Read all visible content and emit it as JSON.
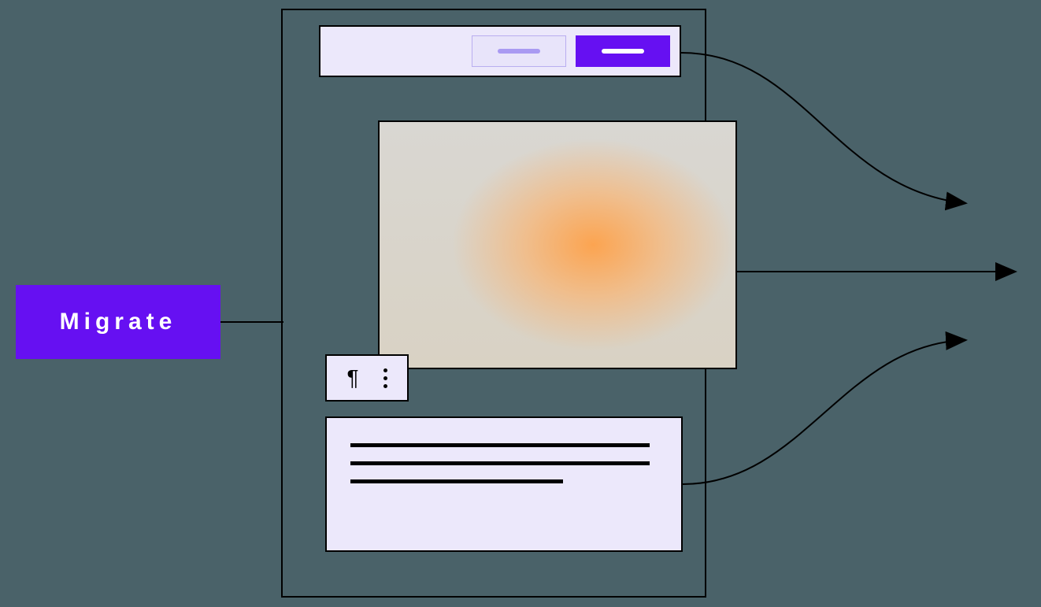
{
  "input": {
    "label": "Migrate"
  },
  "toolbar": {
    "secondary_button": "secondary-action",
    "primary_button": "primary-action"
  },
  "format_bar": {
    "paragraph_icon": "pilcrow-icon",
    "more_icon": "more-vertical-icon"
  },
  "diagram": {
    "text_lines": 3,
    "output_arrows": 3
  },
  "colors": {
    "accent": "#6610f2",
    "panel": "#ece8fb",
    "background": "#4a6269"
  }
}
